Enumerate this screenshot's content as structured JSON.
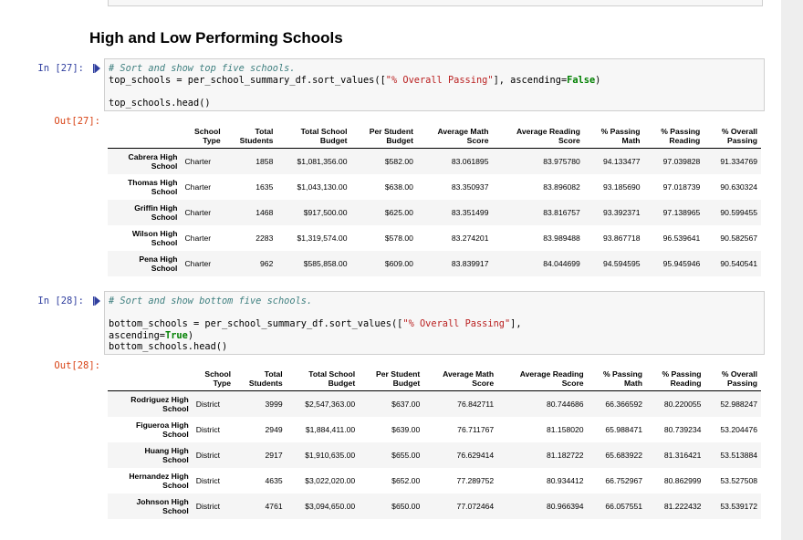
{
  "heading": "High and Low Performing Schools",
  "cells": {
    "in27": {
      "prompt": "In [27]:",
      "comment": "# Sort and show top five schools.",
      "line2_a": "top_schools = per_school_summary_df.sort_values([",
      "line2_str": "\"% Overall Passing\"",
      "line2_b": "], ascending=",
      "line2_kw": "False",
      "line2_c": ")",
      "line3": "top_schools.head()"
    },
    "out27": {
      "prompt": "Out[27]:"
    },
    "in28": {
      "prompt": "In [28]:",
      "comment": "# Sort and show bottom five schools.",
      "line2_a": "bottom_schools = per_school_summary_df.sort_values([",
      "line2_str": "\"% Overall Passing\"",
      "line2_b": "],",
      "line3_a": "ascending=",
      "line3_kw": "True",
      "line3_b": ")",
      "line4": "bottom_schools.head()"
    },
    "out28": {
      "prompt": "Out[28]:"
    }
  },
  "columns": [
    [
      "School",
      "Type"
    ],
    [
      "Total",
      "Students"
    ],
    [
      "Total School",
      "Budget"
    ],
    [
      "Per Student",
      "Budget"
    ],
    [
      "Average Math",
      "Score"
    ],
    [
      "Average Reading",
      "Score"
    ],
    [
      "% Passing",
      "Math"
    ],
    [
      "% Passing",
      "Reading"
    ],
    [
      "% Overall",
      "Passing"
    ]
  ],
  "top_rows": [
    {
      "name": [
        "Cabrera High",
        "School"
      ],
      "cells": [
        "Charter",
        "1858",
        "$1,081,356.00",
        "$582.00",
        "83.061895",
        "83.975780",
        "94.133477",
        "97.039828",
        "91.334769"
      ]
    },
    {
      "name": [
        "Thomas High",
        "School"
      ],
      "cells": [
        "Charter",
        "1635",
        "$1,043,130.00",
        "$638.00",
        "83.350937",
        "83.896082",
        "93.185690",
        "97.018739",
        "90.630324"
      ]
    },
    {
      "name": [
        "Griffin High",
        "School"
      ],
      "cells": [
        "Charter",
        "1468",
        "$917,500.00",
        "$625.00",
        "83.351499",
        "83.816757",
        "93.392371",
        "97.138965",
        "90.599455"
      ]
    },
    {
      "name": [
        "Wilson High",
        "School"
      ],
      "cells": [
        "Charter",
        "2283",
        "$1,319,574.00",
        "$578.00",
        "83.274201",
        "83.989488",
        "93.867718",
        "96.539641",
        "90.582567"
      ]
    },
    {
      "name": [
        "Pena High",
        "School"
      ],
      "cells": [
        "Charter",
        "962",
        "$585,858.00",
        "$609.00",
        "83.839917",
        "84.044699",
        "94.594595",
        "95.945946",
        "90.540541"
      ]
    }
  ],
  "bottom_rows": [
    {
      "name": [
        "Rodriguez High",
        "School"
      ],
      "cells": [
        "District",
        "3999",
        "$2,547,363.00",
        "$637.00",
        "76.842711",
        "80.744686",
        "66.366592",
        "80.220055",
        "52.988247"
      ]
    },
    {
      "name": [
        "Figueroa High",
        "School"
      ],
      "cells": [
        "District",
        "2949",
        "$1,884,411.00",
        "$639.00",
        "76.711767",
        "81.158020",
        "65.988471",
        "80.739234",
        "53.204476"
      ]
    },
    {
      "name": [
        "Huang High",
        "School"
      ],
      "cells": [
        "District",
        "2917",
        "$1,910,635.00",
        "$655.00",
        "76.629414",
        "81.182722",
        "65.683922",
        "81.316421",
        "53.513884"
      ]
    },
    {
      "name": [
        "Hernandez High",
        "School"
      ],
      "cells": [
        "District",
        "4635",
        "$3,022,020.00",
        "$652.00",
        "77.289752",
        "80.934412",
        "66.752967",
        "80.862999",
        "53.527508"
      ]
    },
    {
      "name": [
        "Johnson High",
        "School"
      ],
      "cells": [
        "District",
        "4761",
        "$3,094,650.00",
        "$650.00",
        "77.072464",
        "80.966394",
        "66.057551",
        "81.222432",
        "53.539172"
      ]
    }
  ]
}
